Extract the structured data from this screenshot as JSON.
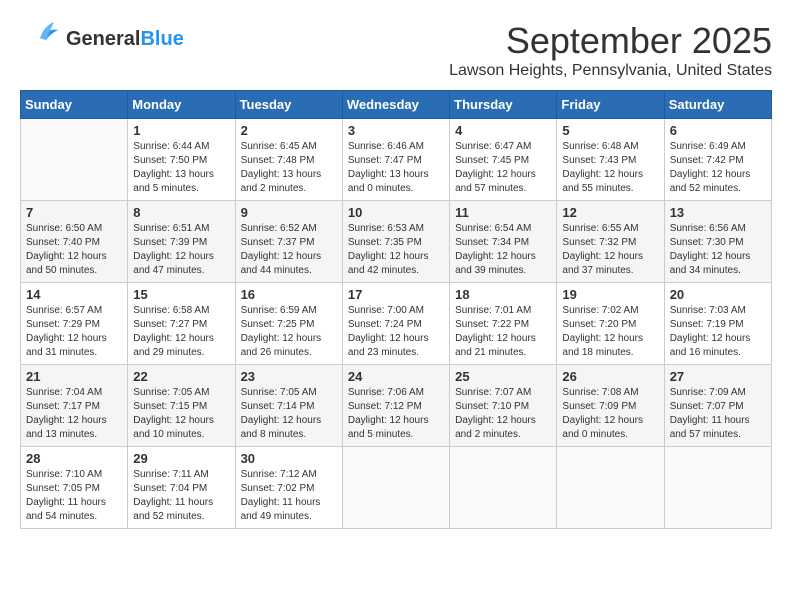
{
  "header": {
    "logo_general": "General",
    "logo_blue": "Blue",
    "month_title": "September 2025",
    "location": "Lawson Heights, Pennsylvania, United States"
  },
  "weekdays": [
    "Sunday",
    "Monday",
    "Tuesday",
    "Wednesday",
    "Thursday",
    "Friday",
    "Saturday"
  ],
  "weeks": [
    [
      {
        "day": "",
        "sunrise": "",
        "sunset": "",
        "daylight": ""
      },
      {
        "day": "1",
        "sunrise": "Sunrise: 6:44 AM",
        "sunset": "Sunset: 7:50 PM",
        "daylight": "Daylight: 13 hours and 5 minutes."
      },
      {
        "day": "2",
        "sunrise": "Sunrise: 6:45 AM",
        "sunset": "Sunset: 7:48 PM",
        "daylight": "Daylight: 13 hours and 2 minutes."
      },
      {
        "day": "3",
        "sunrise": "Sunrise: 6:46 AM",
        "sunset": "Sunset: 7:47 PM",
        "daylight": "Daylight: 13 hours and 0 minutes."
      },
      {
        "day": "4",
        "sunrise": "Sunrise: 6:47 AM",
        "sunset": "Sunset: 7:45 PM",
        "daylight": "Daylight: 12 hours and 57 minutes."
      },
      {
        "day": "5",
        "sunrise": "Sunrise: 6:48 AM",
        "sunset": "Sunset: 7:43 PM",
        "daylight": "Daylight: 12 hours and 55 minutes."
      },
      {
        "day": "6",
        "sunrise": "Sunrise: 6:49 AM",
        "sunset": "Sunset: 7:42 PM",
        "daylight": "Daylight: 12 hours and 52 minutes."
      }
    ],
    [
      {
        "day": "7",
        "sunrise": "Sunrise: 6:50 AM",
        "sunset": "Sunset: 7:40 PM",
        "daylight": "Daylight: 12 hours and 50 minutes."
      },
      {
        "day": "8",
        "sunrise": "Sunrise: 6:51 AM",
        "sunset": "Sunset: 7:39 PM",
        "daylight": "Daylight: 12 hours and 47 minutes."
      },
      {
        "day": "9",
        "sunrise": "Sunrise: 6:52 AM",
        "sunset": "Sunset: 7:37 PM",
        "daylight": "Daylight: 12 hours and 44 minutes."
      },
      {
        "day": "10",
        "sunrise": "Sunrise: 6:53 AM",
        "sunset": "Sunset: 7:35 PM",
        "daylight": "Daylight: 12 hours and 42 minutes."
      },
      {
        "day": "11",
        "sunrise": "Sunrise: 6:54 AM",
        "sunset": "Sunset: 7:34 PM",
        "daylight": "Daylight: 12 hours and 39 minutes."
      },
      {
        "day": "12",
        "sunrise": "Sunrise: 6:55 AM",
        "sunset": "Sunset: 7:32 PM",
        "daylight": "Daylight: 12 hours and 37 minutes."
      },
      {
        "day": "13",
        "sunrise": "Sunrise: 6:56 AM",
        "sunset": "Sunset: 7:30 PM",
        "daylight": "Daylight: 12 hours and 34 minutes."
      }
    ],
    [
      {
        "day": "14",
        "sunrise": "Sunrise: 6:57 AM",
        "sunset": "Sunset: 7:29 PM",
        "daylight": "Daylight: 12 hours and 31 minutes."
      },
      {
        "day": "15",
        "sunrise": "Sunrise: 6:58 AM",
        "sunset": "Sunset: 7:27 PM",
        "daylight": "Daylight: 12 hours and 29 minutes."
      },
      {
        "day": "16",
        "sunrise": "Sunrise: 6:59 AM",
        "sunset": "Sunset: 7:25 PM",
        "daylight": "Daylight: 12 hours and 26 minutes."
      },
      {
        "day": "17",
        "sunrise": "Sunrise: 7:00 AM",
        "sunset": "Sunset: 7:24 PM",
        "daylight": "Daylight: 12 hours and 23 minutes."
      },
      {
        "day": "18",
        "sunrise": "Sunrise: 7:01 AM",
        "sunset": "Sunset: 7:22 PM",
        "daylight": "Daylight: 12 hours and 21 minutes."
      },
      {
        "day": "19",
        "sunrise": "Sunrise: 7:02 AM",
        "sunset": "Sunset: 7:20 PM",
        "daylight": "Daylight: 12 hours and 18 minutes."
      },
      {
        "day": "20",
        "sunrise": "Sunrise: 7:03 AM",
        "sunset": "Sunset: 7:19 PM",
        "daylight": "Daylight: 12 hours and 16 minutes."
      }
    ],
    [
      {
        "day": "21",
        "sunrise": "Sunrise: 7:04 AM",
        "sunset": "Sunset: 7:17 PM",
        "daylight": "Daylight: 12 hours and 13 minutes."
      },
      {
        "day": "22",
        "sunrise": "Sunrise: 7:05 AM",
        "sunset": "Sunset: 7:15 PM",
        "daylight": "Daylight: 12 hours and 10 minutes."
      },
      {
        "day": "23",
        "sunrise": "Sunrise: 7:05 AM",
        "sunset": "Sunset: 7:14 PM",
        "daylight": "Daylight: 12 hours and 8 minutes."
      },
      {
        "day": "24",
        "sunrise": "Sunrise: 7:06 AM",
        "sunset": "Sunset: 7:12 PM",
        "daylight": "Daylight: 12 hours and 5 minutes."
      },
      {
        "day": "25",
        "sunrise": "Sunrise: 7:07 AM",
        "sunset": "Sunset: 7:10 PM",
        "daylight": "Daylight: 12 hours and 2 minutes."
      },
      {
        "day": "26",
        "sunrise": "Sunrise: 7:08 AM",
        "sunset": "Sunset: 7:09 PM",
        "daylight": "Daylight: 12 hours and 0 minutes."
      },
      {
        "day": "27",
        "sunrise": "Sunrise: 7:09 AM",
        "sunset": "Sunset: 7:07 PM",
        "daylight": "Daylight: 11 hours and 57 minutes."
      }
    ],
    [
      {
        "day": "28",
        "sunrise": "Sunrise: 7:10 AM",
        "sunset": "Sunset: 7:05 PM",
        "daylight": "Daylight: 11 hours and 54 minutes."
      },
      {
        "day": "29",
        "sunrise": "Sunrise: 7:11 AM",
        "sunset": "Sunset: 7:04 PM",
        "daylight": "Daylight: 11 hours and 52 minutes."
      },
      {
        "day": "30",
        "sunrise": "Sunrise: 7:12 AM",
        "sunset": "Sunset: 7:02 PM",
        "daylight": "Daylight: 11 hours and 49 minutes."
      },
      {
        "day": "",
        "sunrise": "",
        "sunset": "",
        "daylight": ""
      },
      {
        "day": "",
        "sunrise": "",
        "sunset": "",
        "daylight": ""
      },
      {
        "day": "",
        "sunrise": "",
        "sunset": "",
        "daylight": ""
      },
      {
        "day": "",
        "sunrise": "",
        "sunset": "",
        "daylight": ""
      }
    ]
  ]
}
